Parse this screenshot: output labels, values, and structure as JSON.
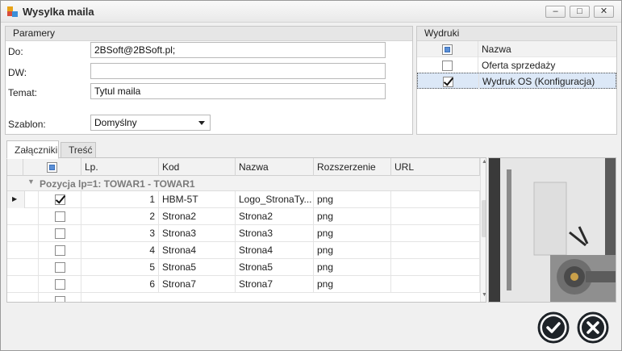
{
  "window": {
    "title": "Wysylka maila",
    "minimize_symbol": "–",
    "maximize_symbol": "□",
    "close_symbol": "✕"
  },
  "params": {
    "header": "Paramery",
    "to_label": "Do:",
    "to_value": "2BSoft@2BSoft.pl;",
    "cc_label": "DW:",
    "cc_value": "",
    "subject_label": "Temat:",
    "subject_value": "Tytul maila",
    "template_label": "Szablon:",
    "template_value": "Domyślny"
  },
  "wydruki": {
    "header": "Wydruki",
    "column_name": "Nazwa",
    "rows": [
      {
        "label": "Oferta sprzedaży",
        "checked": false
      },
      {
        "label": "Wydruk OS (Konfiguracja)",
        "checked": true
      }
    ]
  },
  "tabs": [
    {
      "label": "Załączniki",
      "active": true
    },
    {
      "label": "Treść",
      "active": false
    }
  ],
  "grid": {
    "columns": {
      "lp": "Lp.",
      "kod": "Kod",
      "nazwa": "Nazwa",
      "rozszerzenie": "Rozszerzenie",
      "url": "URL"
    },
    "group_label": "Pozycja lp=1:  TOWAR1 - TOWAR1",
    "rows": [
      {
        "checked": true,
        "lp": "1",
        "kod": "HBM-5T",
        "nazwa": "Logo_StronaTy...",
        "rozszerzenie": "png",
        "url": "",
        "current": true
      },
      {
        "checked": false,
        "lp": "2",
        "kod": "Strona2",
        "nazwa": "Strona2",
        "rozszerzenie": "png",
        "url": ""
      },
      {
        "checked": false,
        "lp": "3",
        "kod": "Strona3",
        "nazwa": "Strona3",
        "rozszerzenie": "png",
        "url": ""
      },
      {
        "checked": false,
        "lp": "4",
        "kod": "Strona4",
        "nazwa": "Strona4",
        "rozszerzenie": "png",
        "url": ""
      },
      {
        "checked": false,
        "lp": "5",
        "kod": "Strona5",
        "nazwa": "Strona5",
        "rozszerzenie": "png",
        "url": ""
      },
      {
        "checked": false,
        "lp": "6",
        "kod": "Strona7",
        "nazwa": "Strona7",
        "rozszerzenie": "png",
        "url": ""
      }
    ]
  },
  "actions": {
    "confirm_icon": "checkmark-icon",
    "cancel_icon": "x-icon"
  },
  "colors": {
    "selection": "#dce8f7",
    "button_dark": "#1e2328",
    "accent_checkbox": "#5b8fd6"
  }
}
